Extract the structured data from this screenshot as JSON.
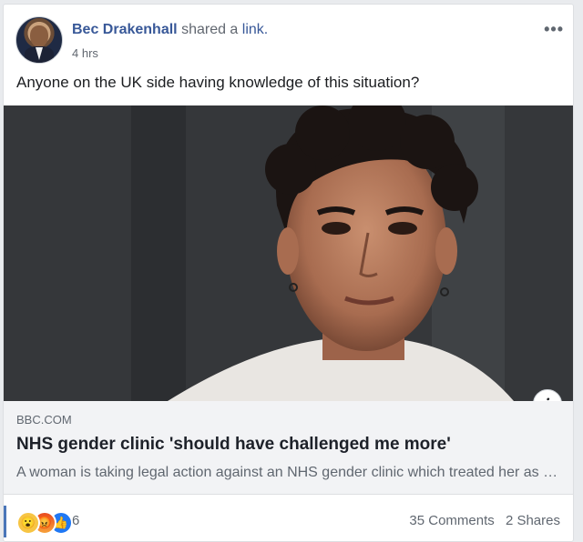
{
  "post": {
    "author": "Bec Drakenhall",
    "shared_text": "shared a",
    "link_word": "link.",
    "time": "4 hrs",
    "more_icon": "•••",
    "text": "Anyone on the UK side having knowledge of this situation?"
  },
  "link_preview": {
    "domain": "BBC.COM",
    "headline": "NHS gender clinic 'should have challenged me more'",
    "description": "A woman is taking legal action against an NHS gender clinic which treated her as a teenager.",
    "info_icon": "i"
  },
  "footer": {
    "reaction_icons": [
      "wow-icon",
      "angry-icon",
      "like-icon"
    ],
    "reaction_count": "6",
    "comments": "35 Comments",
    "shares": "2 Shares"
  },
  "colors": {
    "name_blue": "#385898",
    "like_blue": "#2078f4",
    "text_gray": "#606770"
  }
}
